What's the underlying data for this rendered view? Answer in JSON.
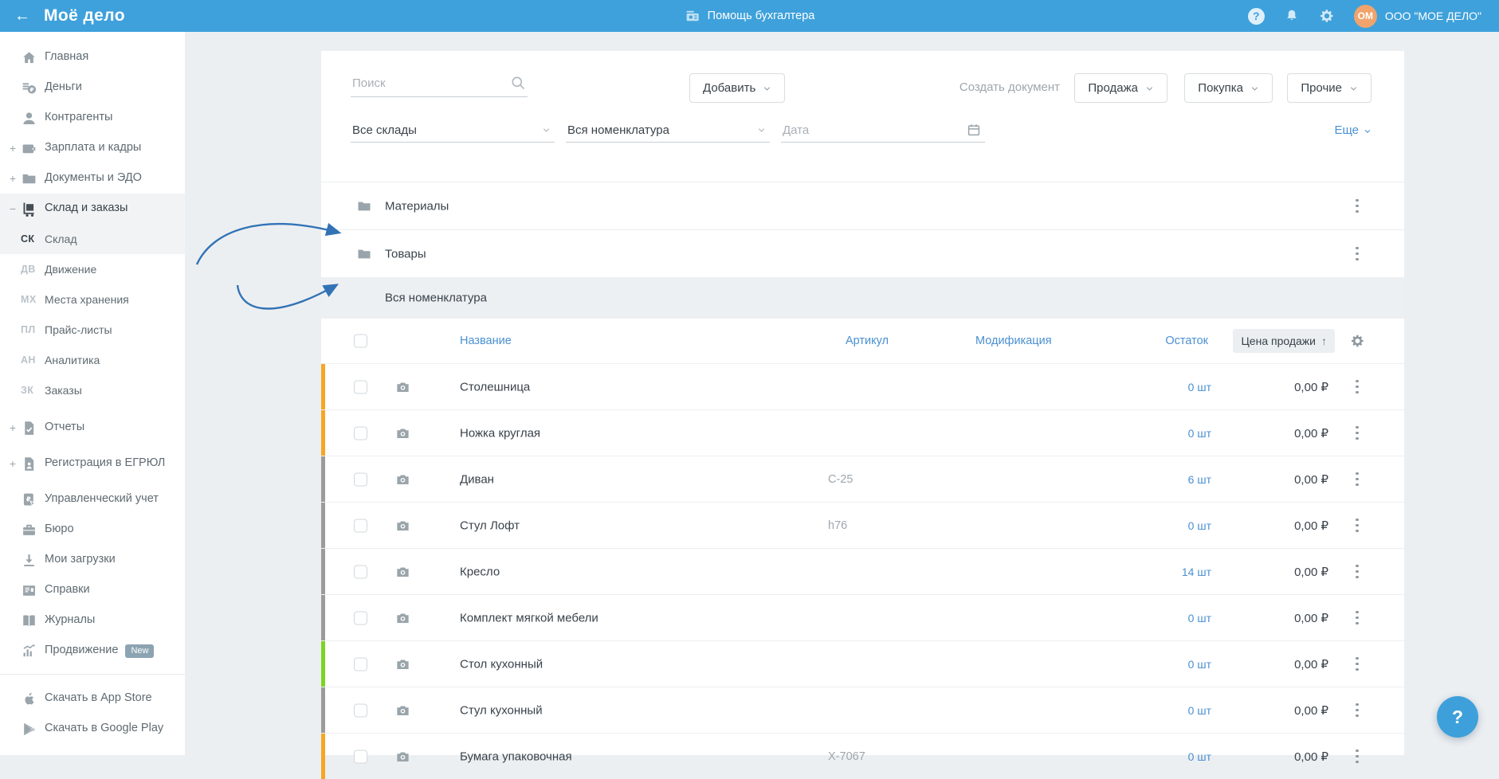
{
  "colors": {
    "topbar_blue": "#3EA1DB",
    "link_blue": "#4A90D2",
    "orange": "#F5A623",
    "green": "#7ED321",
    "gray_bar": "#9B9B9B",
    "avatar_orange": "#F0A46B",
    "badge_gray": "#8CA3B2",
    "arrow_blue": "#3273B5"
  },
  "icons": {
    "back": "arrow-left",
    "assistant": "cash-register",
    "help": "question-circle",
    "notifications": "bell",
    "settings": "gear",
    "search": "magnifier",
    "date": "calendar",
    "folder": "folder",
    "photo": "camera",
    "row_menu": "kebab-vertical",
    "column_settings": "gear",
    "sort": "arrow-up",
    "fab_help": "question-mark"
  },
  "topbar": {
    "logo": "Моё дело",
    "center_label": "Помощь бухгалтера",
    "avatar": "ОМ",
    "company": "ООО \"МОЕ ДЕЛО\""
  },
  "sidebar": {
    "items": [
      {
        "label": "Главная",
        "icon": "home-icon",
        "expand": ""
      },
      {
        "label": "Деньги",
        "icon": "money-icon",
        "expand": ""
      },
      {
        "label": "Контрагенты",
        "icon": "person-icon",
        "expand": ""
      },
      {
        "label": "Зарплата и кадры",
        "icon": "wallet-icon",
        "expand": "+"
      },
      {
        "label": "Документы и ЭДО",
        "icon": "folder-icon",
        "expand": "+"
      },
      {
        "label": "Склад и заказы",
        "icon": "trolley-icon",
        "expand": "−",
        "active": true
      }
    ],
    "sub_items": [
      {
        "code": "СК",
        "label": "Склад",
        "active": true
      },
      {
        "code": "ДВ",
        "label": "Движение"
      },
      {
        "code": "МХ",
        "label": "Места хранения"
      },
      {
        "code": "ПЛ",
        "label": "Прайс-листы"
      },
      {
        "code": "АН",
        "label": "Аналитика"
      },
      {
        "code": "ЗК",
        "label": "Заказы"
      }
    ],
    "items2": [
      {
        "label": "Отчеты",
        "icon": "report-icon",
        "expand": "+"
      },
      {
        "label": "Регистрация в ЕГРЮЛ",
        "icon": "registration-icon",
        "expand": "+"
      },
      {
        "label": "Управленческий учет",
        "icon": "management-icon",
        "expand": ""
      },
      {
        "label": "Бюро",
        "icon": "briefcase-icon",
        "expand": ""
      },
      {
        "label": "Мои загрузки",
        "icon": "download-icon",
        "expand": ""
      },
      {
        "label": "Справки",
        "icon": "news-icon",
        "expand": ""
      },
      {
        "label": "Журналы",
        "icon": "book-icon",
        "expand": ""
      },
      {
        "label": "Продвижение",
        "icon": "promo-icon",
        "expand": "",
        "badge": "New"
      }
    ],
    "store_links": [
      {
        "label": "Скачать в App Store",
        "icon": "apple-icon"
      },
      {
        "label": "Скачать в Google Play",
        "icon": "google-play-icon"
      }
    ]
  },
  "toolbar": {
    "search_placeholder": "Поиск",
    "add_button": "Добавить",
    "create_doc_label": "Создать документ",
    "sale_button": "Продажа",
    "purchase_button": "Покупка",
    "other_button": "Прочие"
  },
  "filters": {
    "warehouse": "Все склады",
    "nomenclature": "Вся номенклатура",
    "date_placeholder": "Дата",
    "more_link": "Еще"
  },
  "folders": [
    {
      "name": "Материалы"
    },
    {
      "name": "Товары"
    }
  ],
  "list": {
    "section_title": "Вся номенклатура",
    "headers": {
      "name": "Название",
      "sku": "Артикул",
      "modification": "Модификация",
      "stock": "Остаток",
      "price": "Цена продажи",
      "sort_arrow": "↑"
    },
    "rows": [
      {
        "name": "Столешница",
        "sku": "",
        "stock": "0 шт",
        "price": "0,00 ₽",
        "bar": "#F5A623"
      },
      {
        "name": "Ножка круглая",
        "sku": "",
        "stock": "0 шт",
        "price": "0,00 ₽",
        "bar": "#F5A623"
      },
      {
        "name": "Диван",
        "sku": "С-25",
        "stock": "6 шт",
        "price": "0,00 ₽",
        "bar": "#9B9B9B"
      },
      {
        "name": "Стул Лофт",
        "sku": "h76",
        "stock": "0 шт",
        "price": "0,00 ₽",
        "bar": "#9B9B9B"
      },
      {
        "name": "Кресло",
        "sku": "",
        "stock": "14 шт",
        "price": "0,00 ₽",
        "bar": "#9B9B9B"
      },
      {
        "name": "Комплект мягкой мебели",
        "sku": "",
        "stock": "0 шт",
        "price": "0,00 ₽",
        "bar": "#9B9B9B"
      },
      {
        "name": "Стол кухонный",
        "sku": "",
        "stock": "0 шт",
        "price": "0,00 ₽",
        "bar": "#7ED321"
      },
      {
        "name": "Стул кухонный",
        "sku": "",
        "stock": "0 шт",
        "price": "0,00 ₽",
        "bar": "#9B9B9B"
      },
      {
        "name": "Бумага упаковочная",
        "sku": "Х-7067",
        "stock": "0 шт",
        "price": "0,00 ₽",
        "bar": "#F5A623"
      }
    ]
  },
  "fab": {
    "label": "?"
  }
}
